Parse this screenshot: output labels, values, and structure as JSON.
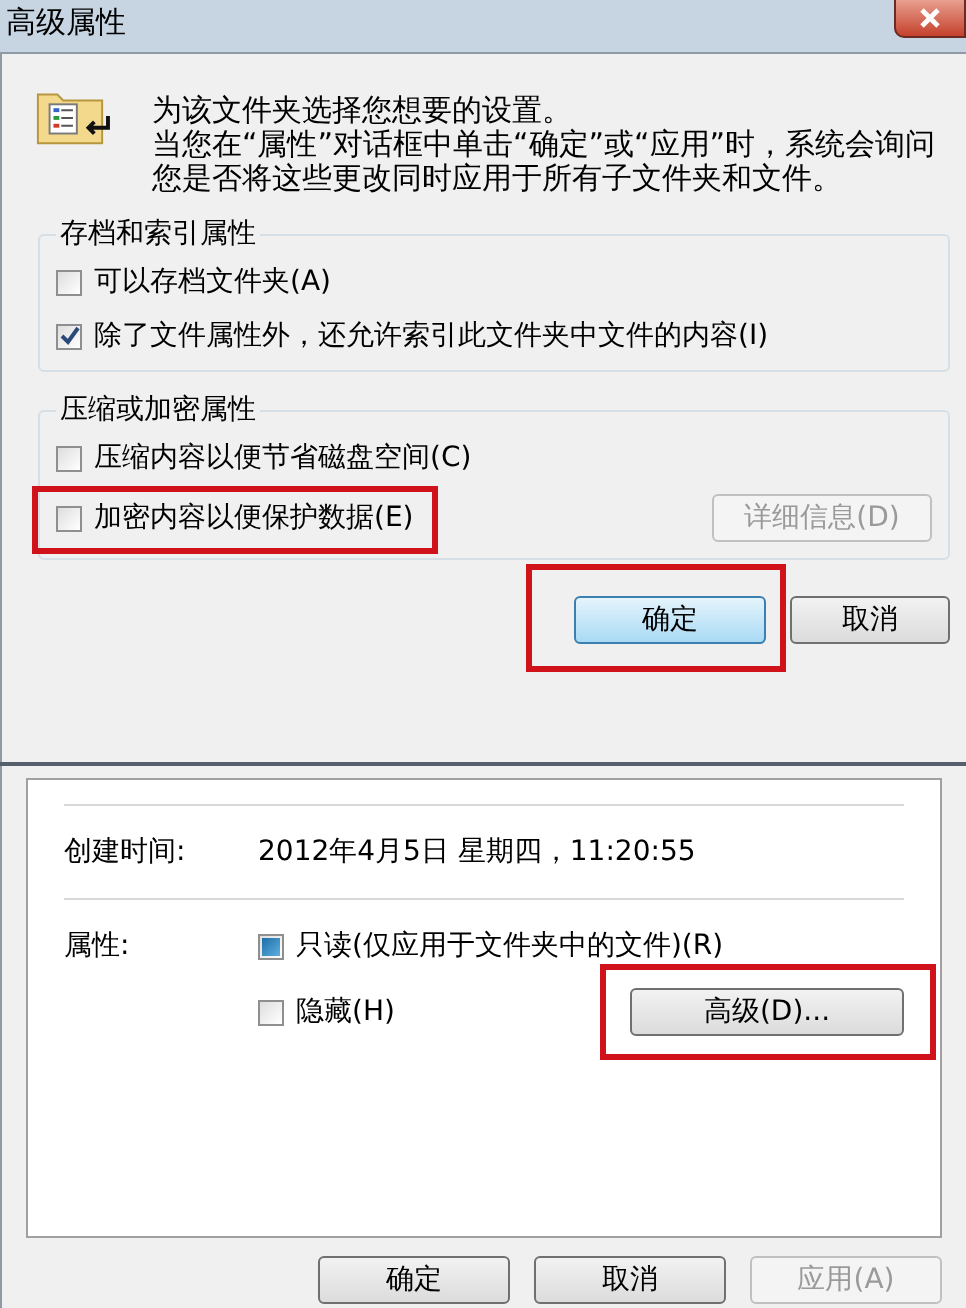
{
  "dialog": {
    "title": "高级属性",
    "intro": [
      "为该文件夹选择您想要的设置。",
      "当您在“属性”对话框中单击“确定”或“应用”时，系统会询问您是否将这些更改同时应用于所有子文件夹和文件。"
    ],
    "groups": [
      {
        "title": "存档和索引属性",
        "options": [
          {
            "label": "可以存档文件夹(A)",
            "checked": false,
            "highlighted": false
          },
          {
            "label": "除了文件属性外，还允许索引此文件夹中文件的内容(I)",
            "checked": true,
            "highlighted": false
          }
        ]
      },
      {
        "title": "压缩或加密属性",
        "options": [
          {
            "label": "压缩内容以便节省磁盘空间(C)",
            "checked": false,
            "highlighted": false
          },
          {
            "label": "加密内容以便保护数据(E)",
            "checked": false,
            "highlighted": true
          }
        ],
        "details_button": {
          "label": "详细信息(D)",
          "disabled": true
        }
      }
    ],
    "buttons": [
      {
        "label": "确定",
        "default": true,
        "highlighted": true
      },
      {
        "label": "取消",
        "default": false,
        "highlighted": false
      }
    ]
  },
  "properties": {
    "created_label": "创建时间:",
    "created_value": "2012年4月5日 星期四，11:20:55",
    "attributes_label": "属性:",
    "attributes": [
      {
        "label": "只读(仅应用于文件夹中的文件)(R)",
        "indeterminate": true
      },
      {
        "label": "隐藏(H)",
        "indeterminate": false
      }
    ],
    "advanced_button": {
      "label": "高级(D)...",
      "highlighted": true
    },
    "buttons": [
      {
        "label": "确定",
        "disabled": false
      },
      {
        "label": "取消",
        "disabled": false
      },
      {
        "label": "应用(A)",
        "disabled": true
      }
    ]
  }
}
